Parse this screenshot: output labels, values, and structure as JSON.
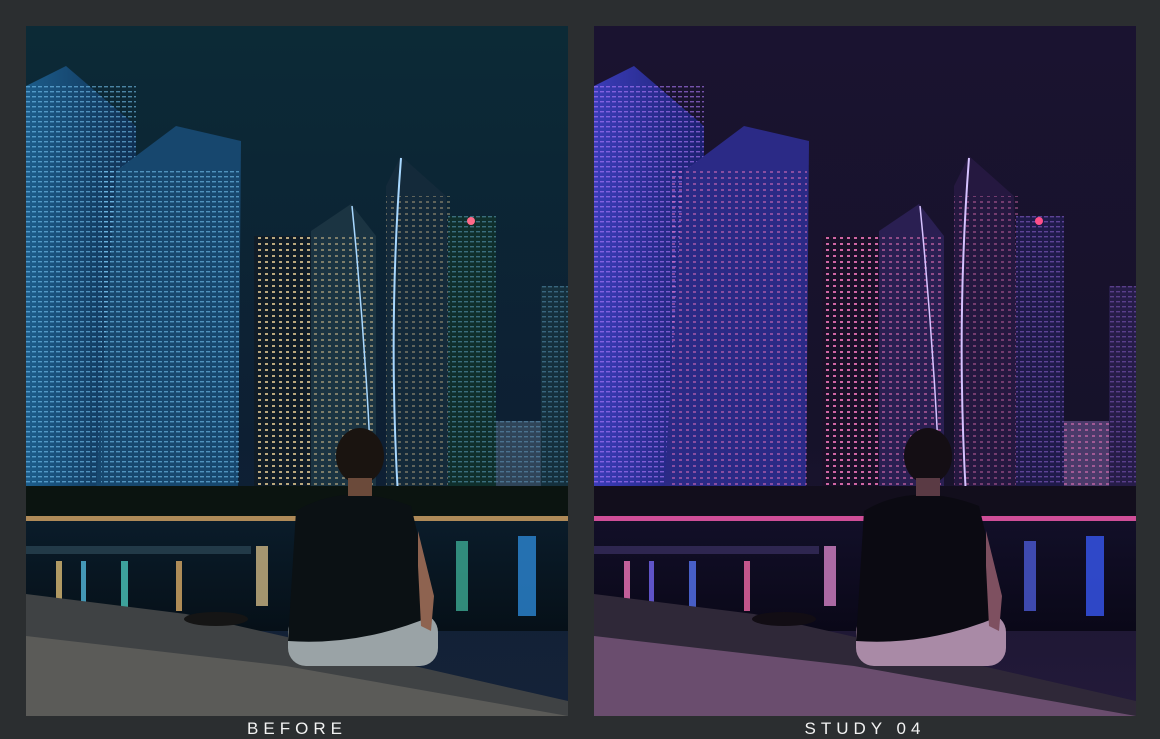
{
  "comparison": {
    "left_label": "BEFORE",
    "right_label": "STUDY 04"
  },
  "scene_description_icons": [
    "city-skyline-night",
    "man-sitting-on-ledge"
  ],
  "palette": {
    "background": "#2b2e30",
    "before_sky": "#0f2a3a",
    "after_sky": "#1c1530",
    "before_glow": "#3fa8ff",
    "after_glow": "#ff4fae"
  }
}
